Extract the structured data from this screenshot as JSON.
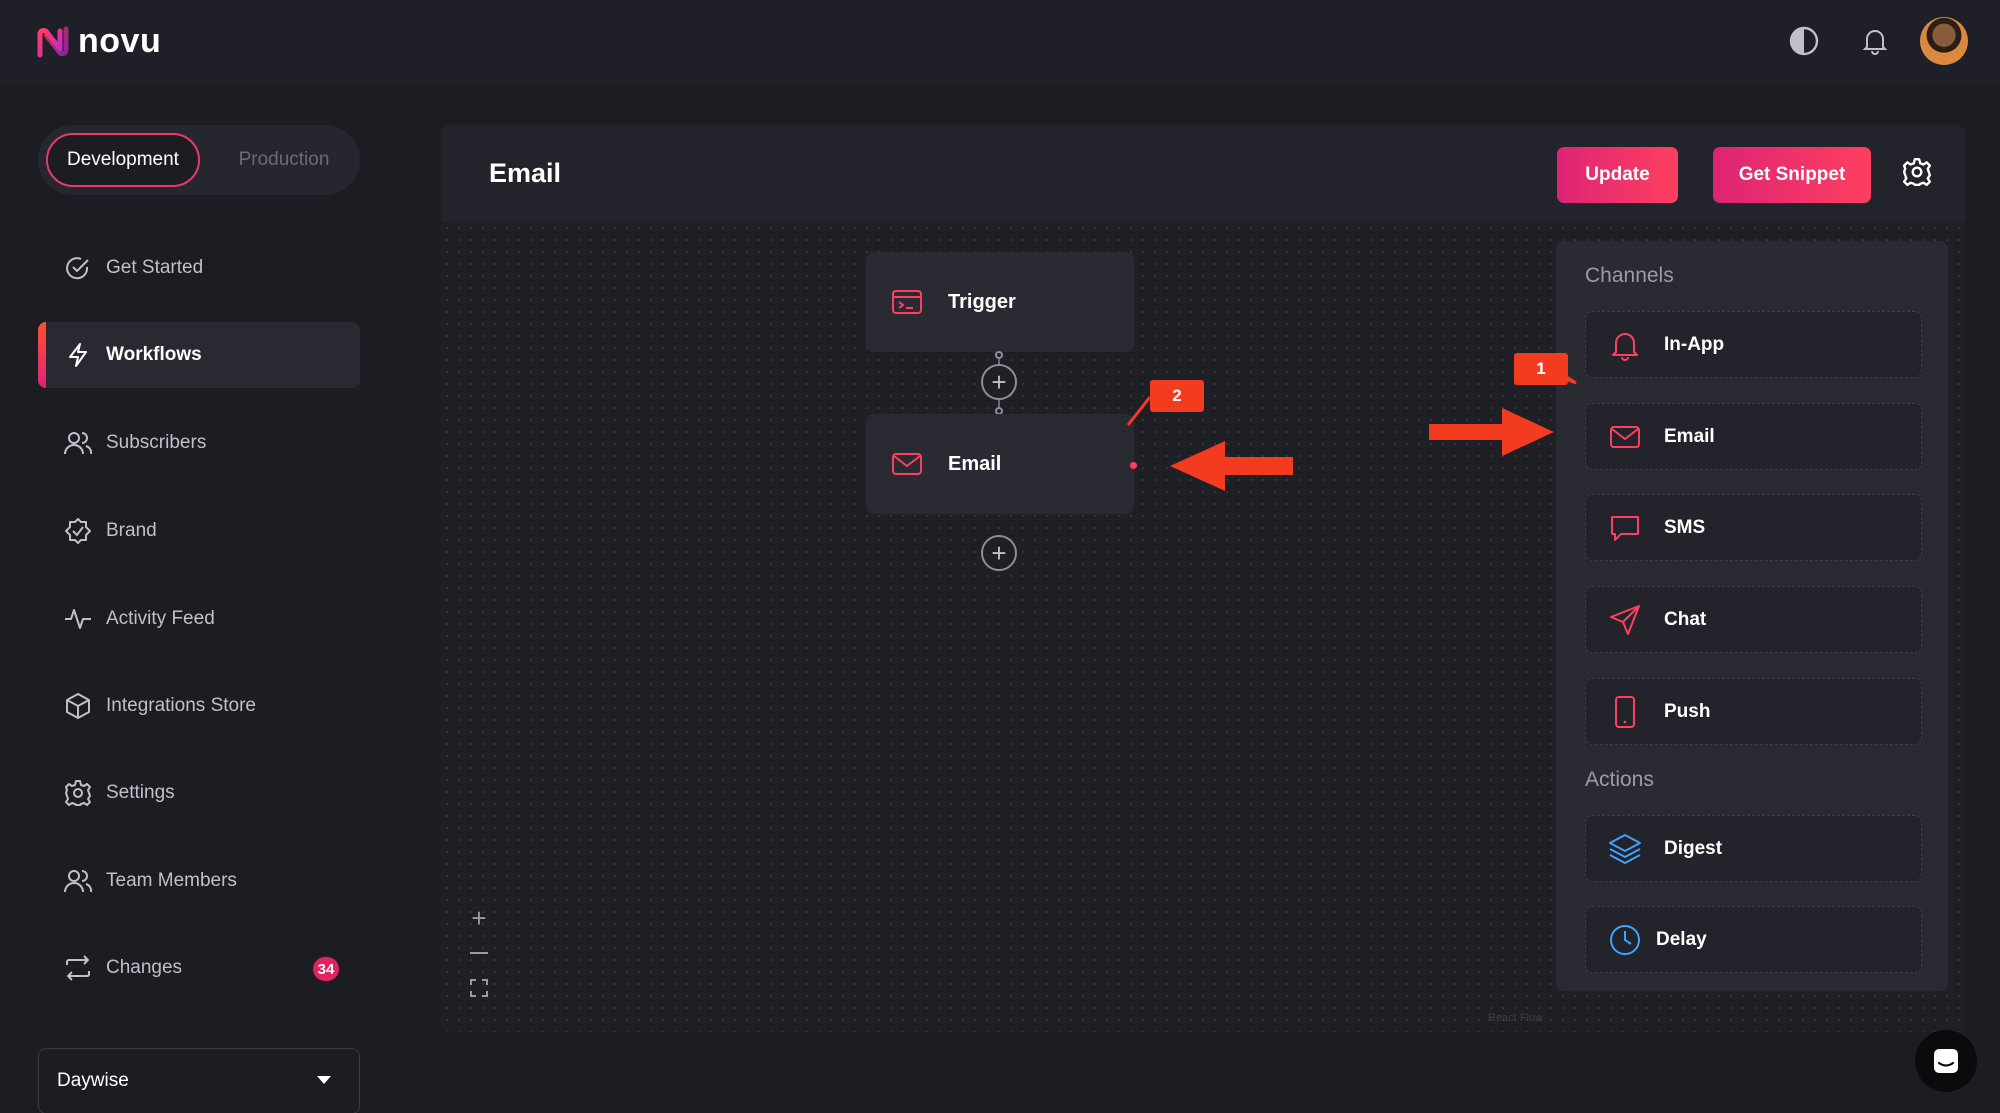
{
  "app": {
    "logo_text": "novu"
  },
  "header": {
    "icons": [
      "theme-toggle-icon",
      "bell-icon",
      "user-avatar"
    ]
  },
  "environment": {
    "development": "Development",
    "production": "Production",
    "active": "Development"
  },
  "sidebar": {
    "items": [
      {
        "label": "Get Started",
        "icon": "check-circle-icon"
      },
      {
        "label": "Workflows",
        "icon": "bolt-icon",
        "active": true
      },
      {
        "label": "Subscribers",
        "icon": "users-icon"
      },
      {
        "label": "Brand",
        "icon": "badge-check-icon"
      },
      {
        "label": "Activity Feed",
        "icon": "activity-icon"
      },
      {
        "label": "Integrations Store",
        "icon": "box-icon"
      },
      {
        "label": "Settings",
        "icon": "gear-icon"
      },
      {
        "label": "Team Members",
        "icon": "users-icon"
      },
      {
        "label": "Changes",
        "icon": "sync-icon",
        "badge": "34"
      }
    ],
    "organization": "Daywise"
  },
  "editor": {
    "title": "Email",
    "update_label": "Update",
    "snippet_label": "Get Snippet",
    "nodes": {
      "trigger": "Trigger",
      "email": "Email"
    },
    "attribution": "React Flow"
  },
  "channels_panel": {
    "channels_title": "Channels",
    "channels": [
      {
        "label": "In-App",
        "icon": "bell-icon"
      },
      {
        "label": "Email",
        "icon": "mail-icon"
      },
      {
        "label": "SMS",
        "icon": "message-icon"
      },
      {
        "label": "Chat",
        "icon": "send-icon"
      },
      {
        "label": "Push",
        "icon": "mobile-icon"
      }
    ],
    "actions_title": "Actions",
    "actions": [
      {
        "label": "Digest",
        "icon": "layers-icon"
      },
      {
        "label": "Delay",
        "icon": "clock-icon"
      }
    ]
  },
  "annotations": {
    "callout_1": "1",
    "callout_2": "2"
  },
  "colors": {
    "accent": "#e8396b",
    "annotation": "#f23b1f",
    "action_blue": "#3ea2ff"
  }
}
